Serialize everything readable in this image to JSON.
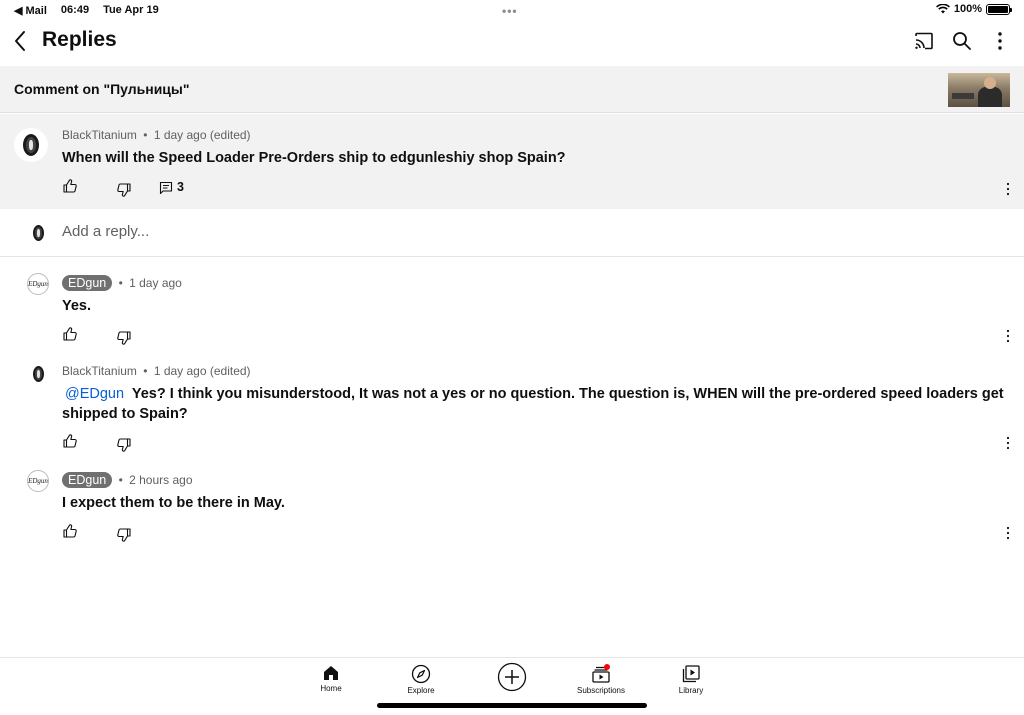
{
  "status_bar": {
    "back_app": "◀ Mail",
    "time": "06:49",
    "date": "Tue Apr 19",
    "battery": "100%"
  },
  "header": {
    "title": "Replies"
  },
  "banner": {
    "text": "Comment on \"Пульницы\""
  },
  "parent_comment": {
    "author": "BlackTitanium",
    "time": "1 day ago (edited)",
    "text": "When will the Speed Loader Pre-Orders ship to edgunleshiy shop Spain?",
    "reply_count": "3"
  },
  "add_reply": {
    "placeholder": "Add a reply..."
  },
  "replies": [
    {
      "author": "EDgun",
      "time": "1 day ago",
      "text": "Yes."
    },
    {
      "author": "BlackTitanium",
      "time": "1 day ago (edited)",
      "mention": "@EDgun",
      "text": "Yes? I think you misunderstood, It was not a yes or no question. The question is, WHEN will the pre-ordered speed loaders get shipped to Spain?"
    },
    {
      "author": "EDgun",
      "time": "2 hours ago",
      "text": "I expect them to be there in May."
    }
  ],
  "avatar_text": "EDgun",
  "separator": "•",
  "nav": {
    "home": "Home",
    "explore": "Explore",
    "subscriptions": "Subscriptions",
    "library": "Library"
  },
  "colors": {
    "accent_blue": "#065fd4",
    "notification_red": "#ff0000",
    "banner_bg": "#f2f2f2"
  }
}
